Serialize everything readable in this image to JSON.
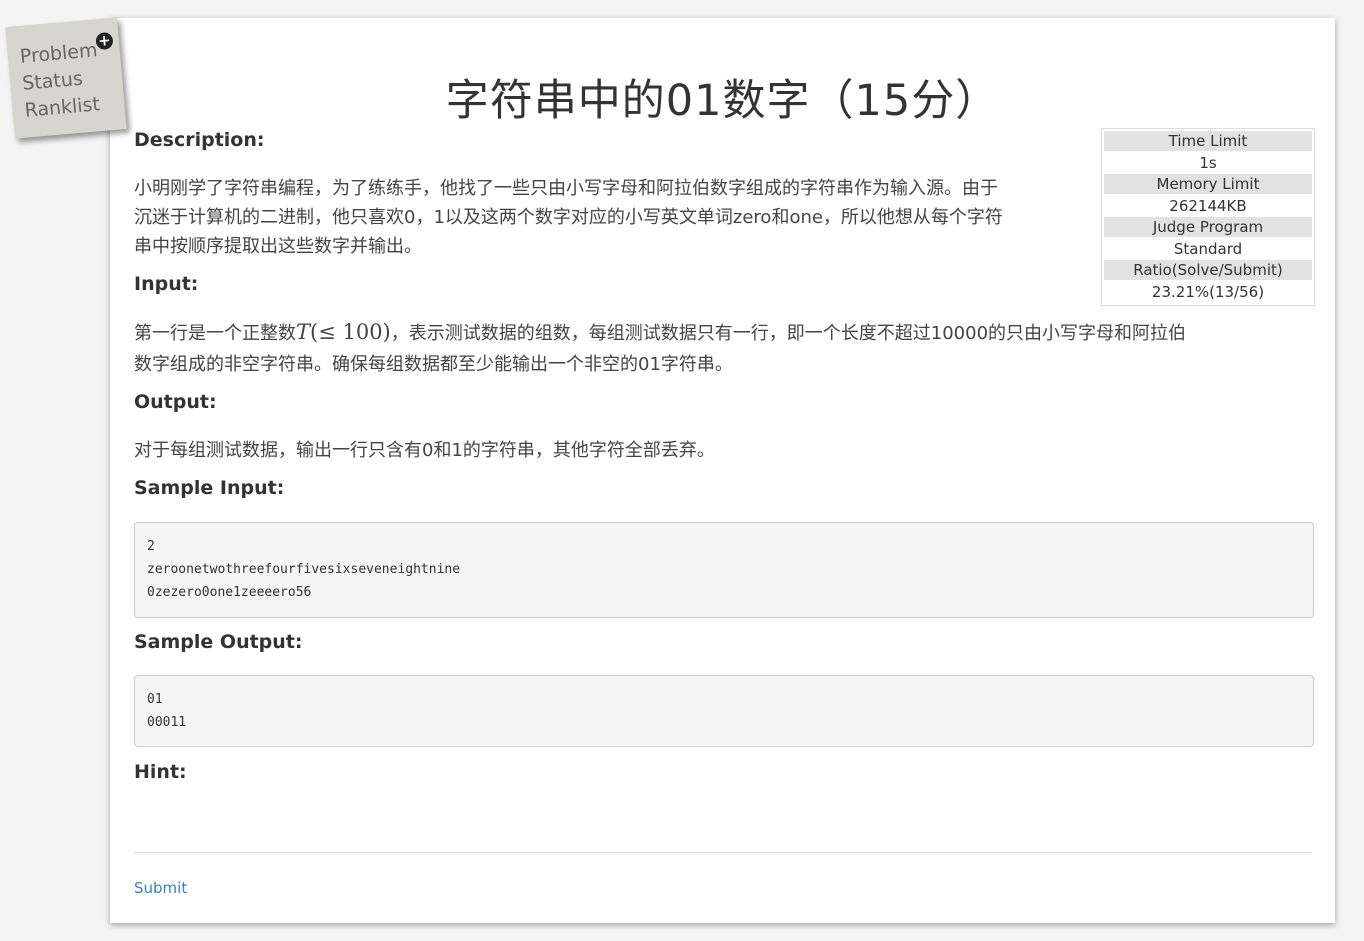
{
  "nav": {
    "items": [
      "Problem",
      "Status",
      "Ranklist"
    ],
    "badge": "+"
  },
  "problem": {
    "title": "字符串中的01数字（15分）",
    "description_heading": "Description:",
    "description_lines": [
      "小明刚学了字符串编程，为了练练手，他找了一些只由小写字母和阿拉伯数字组成的字符串作为输入源。由于",
      "沉迷于计算机的二进制，他只喜欢0，1以及这两个数字对应的小写英文单词zero和one，所以他想从每个字符",
      "串中按顺序提取出这些数字并输出。"
    ],
    "input_heading": "Input:",
    "input_pre": "第一行是一个正整数",
    "input_math_var": "T",
    "input_math_rest": "(≤ 100)",
    "input_post": "，表示测试数据的组数，每组测试数据只有一行，即一个长度不超过10000的只由小写字母和阿拉伯",
    "input_line2": "数字组成的非空字符串。确保每组数据都至少能输出一个非空的01字符串。",
    "output_heading": "Output:",
    "output_text": "对于每组测试数据，输出一行只含有0和1的字符串，其他字符全部丢弃。",
    "sample_input_heading": "Sample Input:",
    "sample_input_lines": [
      "2",
      "zeroonetwothreefourfivesixseveneightnine",
      "0zezero0one1zeeeero56"
    ],
    "sample_output_heading": "Sample Output:",
    "sample_output_lines": [
      "01",
      "00011"
    ],
    "hint_heading": "Hint:",
    "submit_label": "Submit"
  },
  "limits": {
    "time_limit_label": "Time Limit",
    "time_limit_value": "1s",
    "memory_limit_label": "Memory Limit",
    "memory_limit_value": "262144KB",
    "judge_program_label": "Judge Program",
    "judge_program_value": "Standard",
    "ratio_label": "Ratio(Solve/Submit)",
    "ratio_value": "23.21%(13/56)"
  }
}
